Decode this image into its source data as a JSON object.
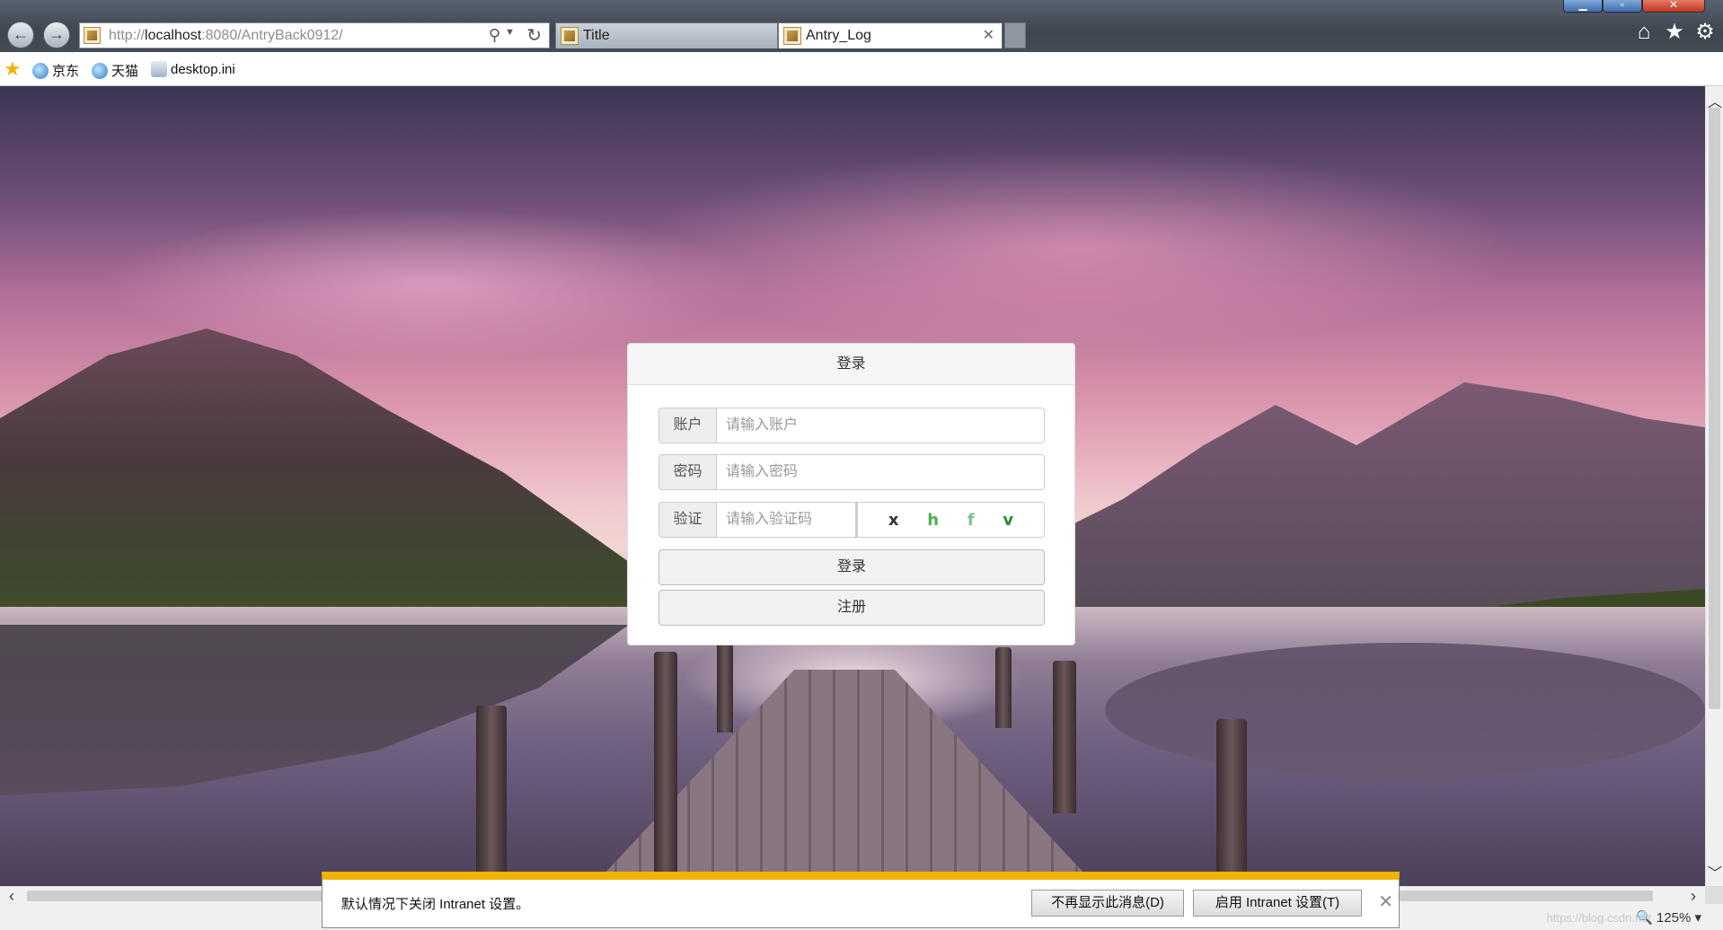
{
  "browser": {
    "address": {
      "url_prefix": "http://",
      "host": "localhost",
      "url_rest": ":8080/AntryBack0912/"
    },
    "tabs": [
      {
        "label": "Title",
        "active": false
      },
      {
        "label": "Antry_Log",
        "active": true
      }
    ],
    "favorites": [
      {
        "label": "京东",
        "icon": "ie-icon"
      },
      {
        "label": "天猫",
        "icon": "ie-icon"
      },
      {
        "label": "desktop.ini",
        "icon": "document-icon"
      }
    ],
    "zoom": "125%",
    "watermark": "https://blog.csdn.net"
  },
  "login": {
    "title": "登录",
    "account": {
      "label": "账户",
      "placeholder": "请输入账户",
      "value": ""
    },
    "password": {
      "label": "密码",
      "placeholder": "请输入密码",
      "value": ""
    },
    "captcha": {
      "label": "验证",
      "placeholder": "请输入验证码",
      "value": "",
      "chars": [
        {
          "char": "x",
          "color": "#333333"
        },
        {
          "char": "h",
          "color": "#4caf50"
        },
        {
          "char": "f",
          "color": "#7fbf8f"
        },
        {
          "char": "v",
          "color": "#2e8b2e"
        }
      ]
    },
    "login_button": "登录",
    "register_button": "注册"
  },
  "notification": {
    "message": "默认情况下关闭 Intranet 设置。",
    "dismiss_button": "不再显示此消息(D)",
    "enable_button": "启用 Intranet 设置(T)",
    "accent_color": "#f0b400"
  }
}
